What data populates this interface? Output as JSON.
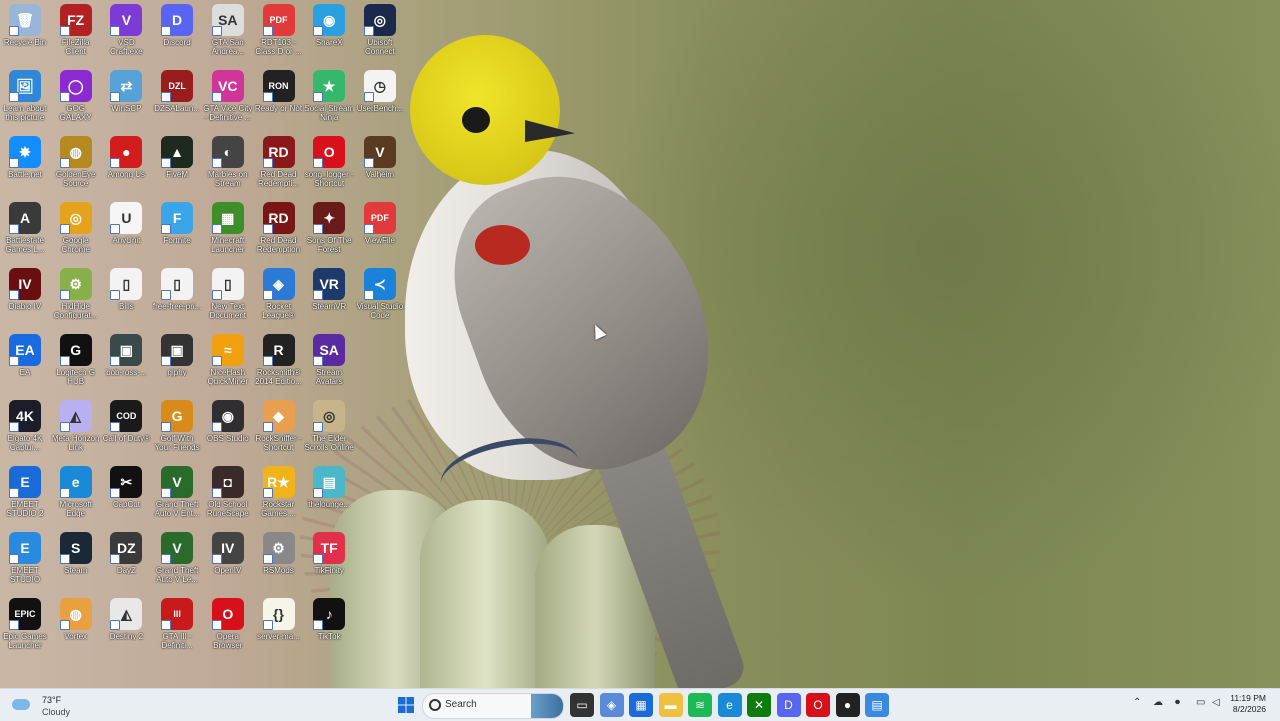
{
  "desktop": {
    "icons": [
      {
        "label": "Recycle Bin",
        "glyph": "🗑",
        "color": "#9ab6d6",
        "col": 0,
        "row": 0
      },
      {
        "label": "FileZilla Client",
        "glyph": "FZ",
        "color": "#b32222",
        "col": 1,
        "row": 0
      },
      {
        "label": "VSD Craft.exe",
        "glyph": "V",
        "color": "#7b3bd4",
        "col": 2,
        "row": 0
      },
      {
        "label": "Discord",
        "glyph": "D",
        "color": "#5865f2",
        "col": 3,
        "row": 0
      },
      {
        "label": "GTA San Andrea...",
        "glyph": "SA",
        "color": "#ddd",
        "col": 4,
        "row": 0
      },
      {
        "label": "RDT103 - Class D or ...",
        "glyph": "PDF",
        "color": "#e03a3a",
        "col": 5,
        "row": 0
      },
      {
        "label": "ShareX",
        "glyph": "◉",
        "color": "#2aa0e0",
        "col": 6,
        "row": 0
      },
      {
        "label": "Ubisoft Connect",
        "glyph": "◎",
        "color": "#1a2a4a",
        "col": 7,
        "row": 0
      },
      {
        "label": "Learn about this picture",
        "glyph": "🖼",
        "color": "#2f87d8",
        "col": 0,
        "row": 1
      },
      {
        "label": "GOG GALAXY",
        "glyph": "◯",
        "color": "#8b2ad0",
        "col": 1,
        "row": 1
      },
      {
        "label": "WinSCP",
        "glyph": "⇄",
        "color": "#56a1d8",
        "col": 2,
        "row": 1
      },
      {
        "label": "DZSALaun...",
        "glyph": "DZL",
        "color": "#9a1d1d",
        "col": 3,
        "row": 1
      },
      {
        "label": "GTA Vice City - Definitive ...",
        "glyph": "VC",
        "color": "#d0359a",
        "col": 4,
        "row": 1
      },
      {
        "label": "Ready or Not",
        "glyph": "RON",
        "color": "#222",
        "col": 5,
        "row": 1
      },
      {
        "label": "Social Stream Ninja",
        "glyph": "★",
        "color": "#36b86a",
        "col": 6,
        "row": 1
      },
      {
        "label": "UserBench...",
        "glyph": "◷",
        "color": "#f3f3f3",
        "col": 7,
        "row": 1
      },
      {
        "label": "Battle.net",
        "glyph": "✸",
        "color": "#148eff",
        "col": 0,
        "row": 2
      },
      {
        "label": "GoldenEye Source",
        "glyph": "◍",
        "color": "#b58a20",
        "col": 1,
        "row": 2
      },
      {
        "label": "Among Us",
        "glyph": "●",
        "color": "#d11d1d",
        "col": 2,
        "row": 2
      },
      {
        "label": "FiveM",
        "glyph": "▲",
        "color": "#1d2a1d",
        "col": 3,
        "row": 2
      },
      {
        "label": "Marbles on Stream",
        "glyph": "◐",
        "color": "#444",
        "col": 4,
        "row": 2
      },
      {
        "label": "Red Dead Redempti...",
        "glyph": "RD",
        "color": "#8a1a1a",
        "col": 5,
        "row": 2
      },
      {
        "label": "song_logger - Shortcut",
        "glyph": "O",
        "color": "#d8101c",
        "col": 6,
        "row": 2
      },
      {
        "label": "Valheim",
        "glyph": "V",
        "color": "#5a3a20",
        "col": 7,
        "row": 2
      },
      {
        "label": "Battlestate Games L...",
        "glyph": "A",
        "color": "#3a3a3a",
        "col": 0,
        "row": 3
      },
      {
        "label": "Google Chrome",
        "glyph": "◎",
        "color": "#e5a31b",
        "col": 1,
        "row": 3
      },
      {
        "label": "AnyUnit",
        "glyph": "U",
        "color": "#f5f5f5",
        "col": 2,
        "row": 3
      },
      {
        "label": "Fortnite",
        "glyph": "F",
        "color": "#3aa6e8",
        "col": 3,
        "row": 3
      },
      {
        "label": "Minecraft Launcher",
        "glyph": "▦",
        "color": "#3e8e2a",
        "col": 4,
        "row": 3
      },
      {
        "label": "Red Dead Redemption",
        "glyph": "RD",
        "color": "#7a1515",
        "col": 5,
        "row": 3
      },
      {
        "label": "Sons Of The Forest",
        "glyph": "✦",
        "color": "#6a1a1a",
        "col": 6,
        "row": 3
      },
      {
        "label": "ViewFile",
        "glyph": "PDF",
        "color": "#e03a3a",
        "col": 7,
        "row": 3
      },
      {
        "label": "Diablo IV",
        "glyph": "IV",
        "color": "#6a0f0f",
        "col": 0,
        "row": 4
      },
      {
        "label": "HidHide Configurat...",
        "glyph": "⚙",
        "color": "#88b04a",
        "col": 1,
        "row": 4
      },
      {
        "label": "Bills",
        "glyph": "▯",
        "color": "#f3f3f3",
        "col": 2,
        "row": 4
      },
      {
        "label": "free-free-pri...",
        "glyph": "▯",
        "color": "#f3f3f3",
        "col": 3,
        "row": 4
      },
      {
        "label": "New Text Document",
        "glyph": "▯",
        "color": "#f3f3f3",
        "col": 4,
        "row": 4
      },
      {
        "label": "Rocket League®",
        "glyph": "◈",
        "color": "#2a7ad6",
        "col": 5,
        "row": 4
      },
      {
        "label": "SteamVR",
        "glyph": "VR",
        "color": "#1d3a6a",
        "col": 6,
        "row": 4
      },
      {
        "label": "Visual Studio Code",
        "glyph": "≺",
        "color": "#1a82d8",
        "col": 7,
        "row": 4
      },
      {
        "label": "EA",
        "glyph": "EA",
        "color": "#1b6be0",
        "col": 0,
        "row": 5
      },
      {
        "label": "Logitech G HUB",
        "glyph": "G",
        "color": "#111",
        "col": 1,
        "row": 5
      },
      {
        "label": "bob-ross-...",
        "glyph": "▣",
        "color": "#3a4a4a",
        "col": 2,
        "row": 5
      },
      {
        "label": "giphy",
        "glyph": "▣",
        "color": "#333",
        "col": 3,
        "row": 5
      },
      {
        "label": "NiceHash QuickMiner",
        "glyph": "≈",
        "color": "#f0a010",
        "col": 4,
        "row": 5
      },
      {
        "label": "Rocksmith® 2014 Editio...",
        "glyph": "R",
        "color": "#222",
        "col": 5,
        "row": 5
      },
      {
        "label": "Stream Avatars",
        "glyph": "SA",
        "color": "#5a2aa0",
        "col": 6,
        "row": 5
      },
      {
        "label": "Elgato 4K Captur...",
        "glyph": "4K",
        "color": "#1d1d2a",
        "col": 0,
        "row": 6
      },
      {
        "label": "Meta Horizon Link",
        "glyph": "◭",
        "color": "#b8b0f0",
        "col": 1,
        "row": 6
      },
      {
        "label": "Call of Duty®",
        "glyph": "COD",
        "color": "#1a1a1a",
        "col": 2,
        "row": 6
      },
      {
        "label": "Golf With Your Friends",
        "glyph": "G",
        "color": "#d88a1a",
        "col": 3,
        "row": 6
      },
      {
        "label": "OBS Studio",
        "glyph": "◉",
        "color": "#302e31",
        "col": 4,
        "row": 6
      },
      {
        "label": "RockSniffer - Shortcut",
        "glyph": "◆",
        "color": "#e8a050",
        "col": 5,
        "row": 6
      },
      {
        "label": "The Elder Scrolls Online",
        "glyph": "◎",
        "color": "#c8b48a",
        "col": 6,
        "row": 6
      },
      {
        "label": "EMEET STUDIO 2",
        "glyph": "E",
        "color": "#1a6ad8",
        "col": 0,
        "row": 7
      },
      {
        "label": "Microsoft Edge",
        "glyph": "e",
        "color": "#1a8ad8",
        "col": 1,
        "row": 7
      },
      {
        "label": "CapCut",
        "glyph": "✂",
        "color": "#111",
        "col": 2,
        "row": 7
      },
      {
        "label": "Grand Theft Auto V Ent...",
        "glyph": "V",
        "color": "#2a6a2a",
        "col": 3,
        "row": 7
      },
      {
        "label": "Old School RuneScape",
        "glyph": "◘",
        "color": "#3a2a2a",
        "col": 4,
        "row": 7
      },
      {
        "label": "Rockstar Games ...",
        "glyph": "R★",
        "color": "#f0b41a",
        "col": 5,
        "row": 7
      },
      {
        "label": "thelounge...",
        "glyph": "▤",
        "color": "#4ab8c8",
        "col": 6,
        "row": 7
      },
      {
        "label": "EMEET STUDIO",
        "glyph": "E",
        "color": "#2a8ae0",
        "col": 0,
        "row": 8
      },
      {
        "label": "Steam",
        "glyph": "S",
        "color": "#1b2838",
        "col": 1,
        "row": 8
      },
      {
        "label": "DayZ",
        "glyph": "DZ",
        "color": "#3a3a3a",
        "col": 2,
        "row": 8
      },
      {
        "label": "Grand Theft Auto V Le...",
        "glyph": "V",
        "color": "#2a6a2a",
        "col": 3,
        "row": 8
      },
      {
        "label": "OpenIV",
        "glyph": "IV",
        "color": "#444",
        "col": 4,
        "row": 8
      },
      {
        "label": "RSMods",
        "glyph": "⚙",
        "color": "#888",
        "col": 5,
        "row": 8
      },
      {
        "label": "TikFinity",
        "glyph": "TF",
        "color": "#e0304a",
        "col": 6,
        "row": 8
      },
      {
        "label": "Epic Games Launcher",
        "glyph": "EPIC",
        "color": "#111",
        "col": 0,
        "row": 9
      },
      {
        "label": "Vortex",
        "glyph": "◍",
        "color": "#e8a040",
        "col": 1,
        "row": 9
      },
      {
        "label": "Destiny 2",
        "glyph": "◭",
        "color": "#e8e8e8",
        "col": 2,
        "row": 9
      },
      {
        "label": "GTA III - Definiti...",
        "glyph": "III",
        "color": "#c81a1a",
        "col": 3,
        "row": 9
      },
      {
        "label": "Opera Browser",
        "glyph": "O",
        "color": "#d8101c",
        "col": 4,
        "row": 9
      },
      {
        "label": "server-ma...",
        "glyph": "{}",
        "color": "#f5f5e8",
        "col": 5,
        "row": 9
      },
      {
        "label": "TikTok",
        "glyph": "♪",
        "color": "#111",
        "col": 6,
        "row": 9
      }
    ]
  },
  "taskbar": {
    "weather": {
      "temp": "73°F",
      "condition": "Cloudy"
    },
    "search_placeholder": "Search",
    "apps": [
      {
        "name": "task-view",
        "glyph": "▭",
        "color": "#333"
      },
      {
        "name": "copilot",
        "glyph": "◈",
        "color": "#5a8ad8"
      },
      {
        "name": "store",
        "glyph": "▦",
        "color": "#1a6ad8"
      },
      {
        "name": "file-explorer",
        "glyph": "▬",
        "color": "#f0c040"
      },
      {
        "name": "spotify",
        "glyph": "≋",
        "color": "#1db954"
      },
      {
        "name": "edge",
        "glyph": "e",
        "color": "#1a8ad8"
      },
      {
        "name": "xbox",
        "glyph": "✕",
        "color": "#107c10"
      },
      {
        "name": "discord",
        "glyph": "D",
        "color": "#5865f2"
      },
      {
        "name": "opera",
        "glyph": "O",
        "color": "#d8101c"
      },
      {
        "name": "recorder",
        "glyph": "●",
        "color": "#222"
      },
      {
        "name": "app-active",
        "glyph": "▤",
        "color": "#3a8ae0"
      }
    ],
    "clock": {
      "time": "11:19 PM",
      "date": "8/2/2026"
    }
  }
}
